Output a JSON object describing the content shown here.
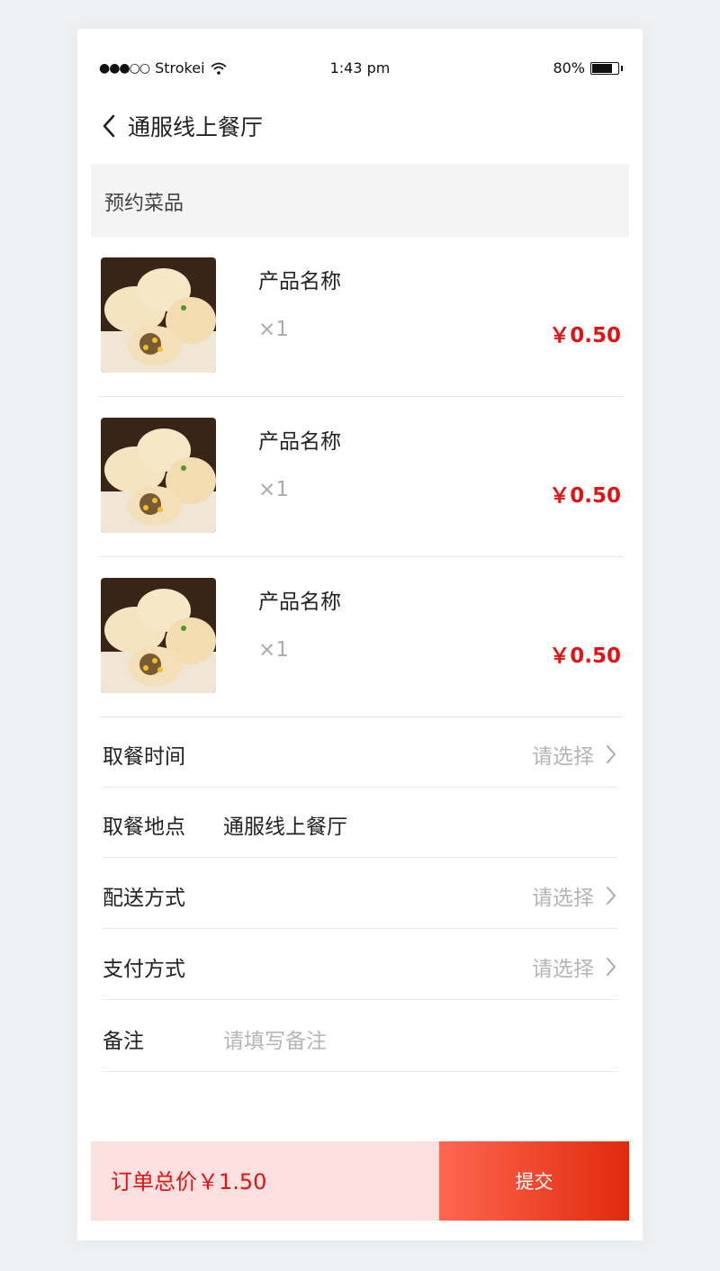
{
  "status_bar": {
    "carrier": "Strokei",
    "time": "1:43 pm",
    "battery": "80%",
    "battery_level": 0.8
  },
  "nav": {
    "title": "通服线上餐厅"
  },
  "section": {
    "title": "预约菜品"
  },
  "items": [
    {
      "name": "产品名称",
      "qty": "×1",
      "price": "￥0.50"
    },
    {
      "name": "产品名称",
      "qty": "×1",
      "price": "￥0.50"
    },
    {
      "name": "产品名称",
      "qty": "×1",
      "price": "￥0.50"
    }
  ],
  "form": {
    "pickup_time": {
      "label": "取餐时间",
      "placeholder": "请选择"
    },
    "pickup_place": {
      "label": "取餐地点",
      "value": "通服线上餐厅"
    },
    "delivery": {
      "label": "配送方式",
      "placeholder": "请选择"
    },
    "payment": {
      "label": "支付方式",
      "placeholder": "请选择"
    },
    "note": {
      "label": "备注",
      "placeholder": "请填写备注"
    }
  },
  "footer": {
    "total": "订单总价￥1.50",
    "submit": "提交"
  },
  "colors": {
    "accent": "#e41313",
    "submit_start": "#ff6650",
    "submit_end": "#e02a0d",
    "total_bg": "#fde0e0"
  }
}
